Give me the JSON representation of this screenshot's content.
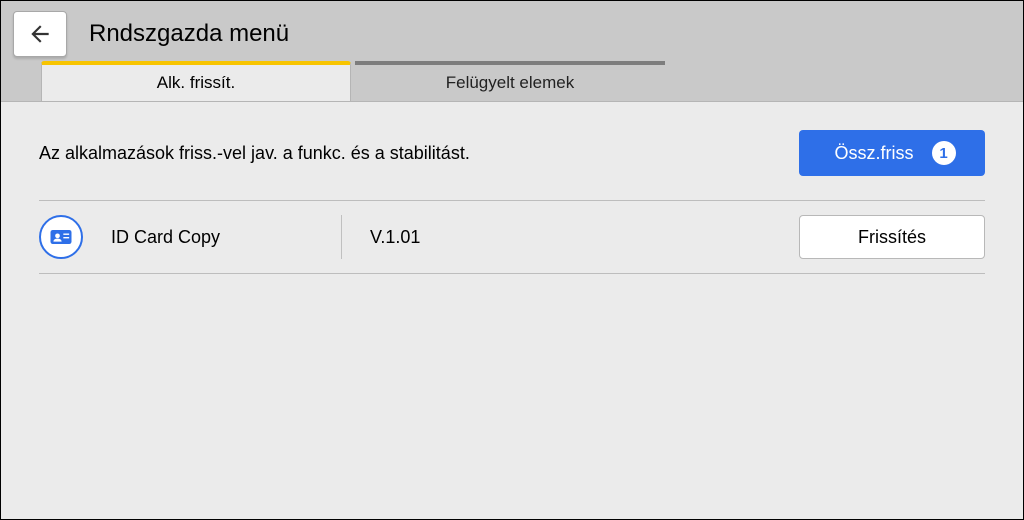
{
  "header": {
    "title": "Rndszgazda menü"
  },
  "tabs": {
    "active": "Alk. frissít.",
    "inactive": "Felügyelt elemek"
  },
  "content": {
    "description": "Az alkalmazások friss.-vel jav. a funkc. és a stabilitást.",
    "update_all_label": "Össz.friss",
    "update_all_count": "1"
  },
  "apps": [
    {
      "name": "ID Card Copy",
      "version": "V.1.01",
      "update_label": "Frissítés"
    }
  ]
}
